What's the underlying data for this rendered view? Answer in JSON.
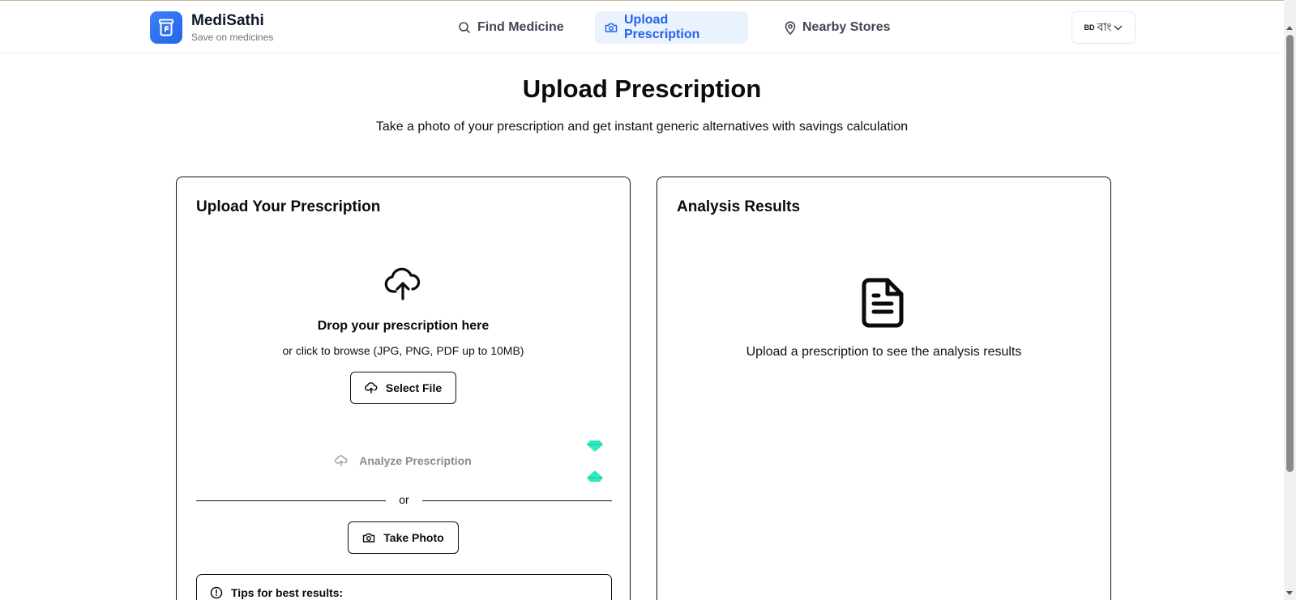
{
  "header": {
    "brand_name": "MediSathi",
    "brand_tagline": "Save on medicines",
    "nav": [
      {
        "label": "Find Medicine",
        "icon": "search-icon",
        "active": false
      },
      {
        "label": "Upload Prescription",
        "icon": "camera-icon",
        "active": true
      },
      {
        "label": "Nearby Stores",
        "icon": "map-pin-icon",
        "active": false
      }
    ],
    "language": {
      "flag": "BD",
      "label": "বাং"
    }
  },
  "page": {
    "title": "Upload Prescription",
    "subtitle": "Take a photo of your prescription and get instant generic alternatives with savings calculation"
  },
  "upload_card": {
    "title": "Upload Your Prescription",
    "drop_title": "Drop your prescription here",
    "drop_subtitle": "or click to browse (JPG, PNG, PDF up to 10MB)",
    "select_file_label": "Select File",
    "analyze_label": "Analyze Prescription",
    "divider_text": "or",
    "take_photo_label": "Take Photo",
    "tips_title": "Tips for best results:"
  },
  "results_card": {
    "title": "Analysis Results",
    "empty_text": "Upload a prescription to see the analysis results"
  },
  "colors": {
    "accent": "#2563eb",
    "active_nav_bg": "#eaf2fe",
    "gem": "#2ee8c0"
  }
}
